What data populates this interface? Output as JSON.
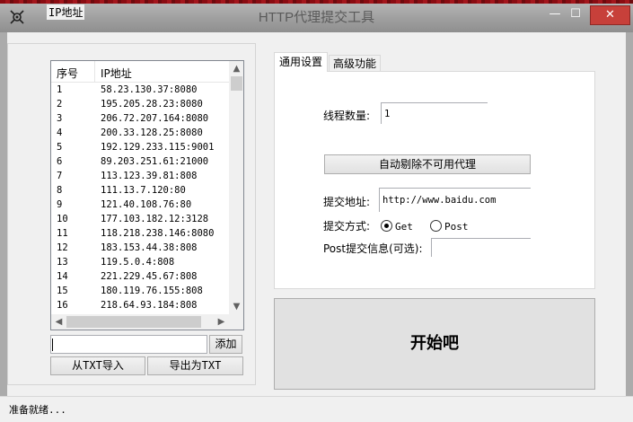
{
  "window": {
    "title": "HTTP代理提交工具",
    "controls": {
      "minimize": "—",
      "maximize": "☐",
      "close": "✕"
    }
  },
  "ip_group": {
    "title": "IP地址",
    "columns": [
      "序号",
      "IP地址"
    ],
    "rows": [
      [
        "1",
        "58.23.130.37:8080"
      ],
      [
        "2",
        "195.205.28.23:8080"
      ],
      [
        "3",
        "206.72.207.164:8080"
      ],
      [
        "4",
        "200.33.128.25:8080"
      ],
      [
        "5",
        "192.129.233.115:9001"
      ],
      [
        "6",
        "89.203.251.61:21000"
      ],
      [
        "7",
        "113.123.39.81:808"
      ],
      [
        "8",
        "111.13.7.120:80"
      ],
      [
        "9",
        "121.40.108.76:80"
      ],
      [
        "10",
        "177.103.182.12:3128"
      ],
      [
        "11",
        "118.218.238.146:8080"
      ],
      [
        "12",
        "183.153.44.38:808"
      ],
      [
        "13",
        "119.5.0.4:808"
      ],
      [
        "14",
        "221.229.45.67:808"
      ],
      [
        "15",
        "180.119.76.155:808"
      ],
      [
        "16",
        "218.64.93.184:808"
      ]
    ],
    "add_input_value": "",
    "add_button": "添加",
    "import_button": "从TXT导入",
    "export_button": "导出为TXT"
  },
  "tabs": [
    "通用设置",
    "高级功能"
  ],
  "settings": {
    "thread_label": "线程数量:",
    "thread_value": "1",
    "autoremove_button": "自动剔除不可用代理",
    "url_label": "提交地址:",
    "url_value": "http://www.baidu.com",
    "method_label": "提交方式:",
    "method_get": "Get",
    "method_post": "Post",
    "method_selected": "Get",
    "post_info_label": "Post提交信息(可选):",
    "post_info_value": ""
  },
  "start_button": "开始吧",
  "status_text": "准备就绪...",
  "colors": {
    "close_button": "#c7403a",
    "titlebar": "#9e9e9e",
    "title_text": "#5a5a5a"
  }
}
